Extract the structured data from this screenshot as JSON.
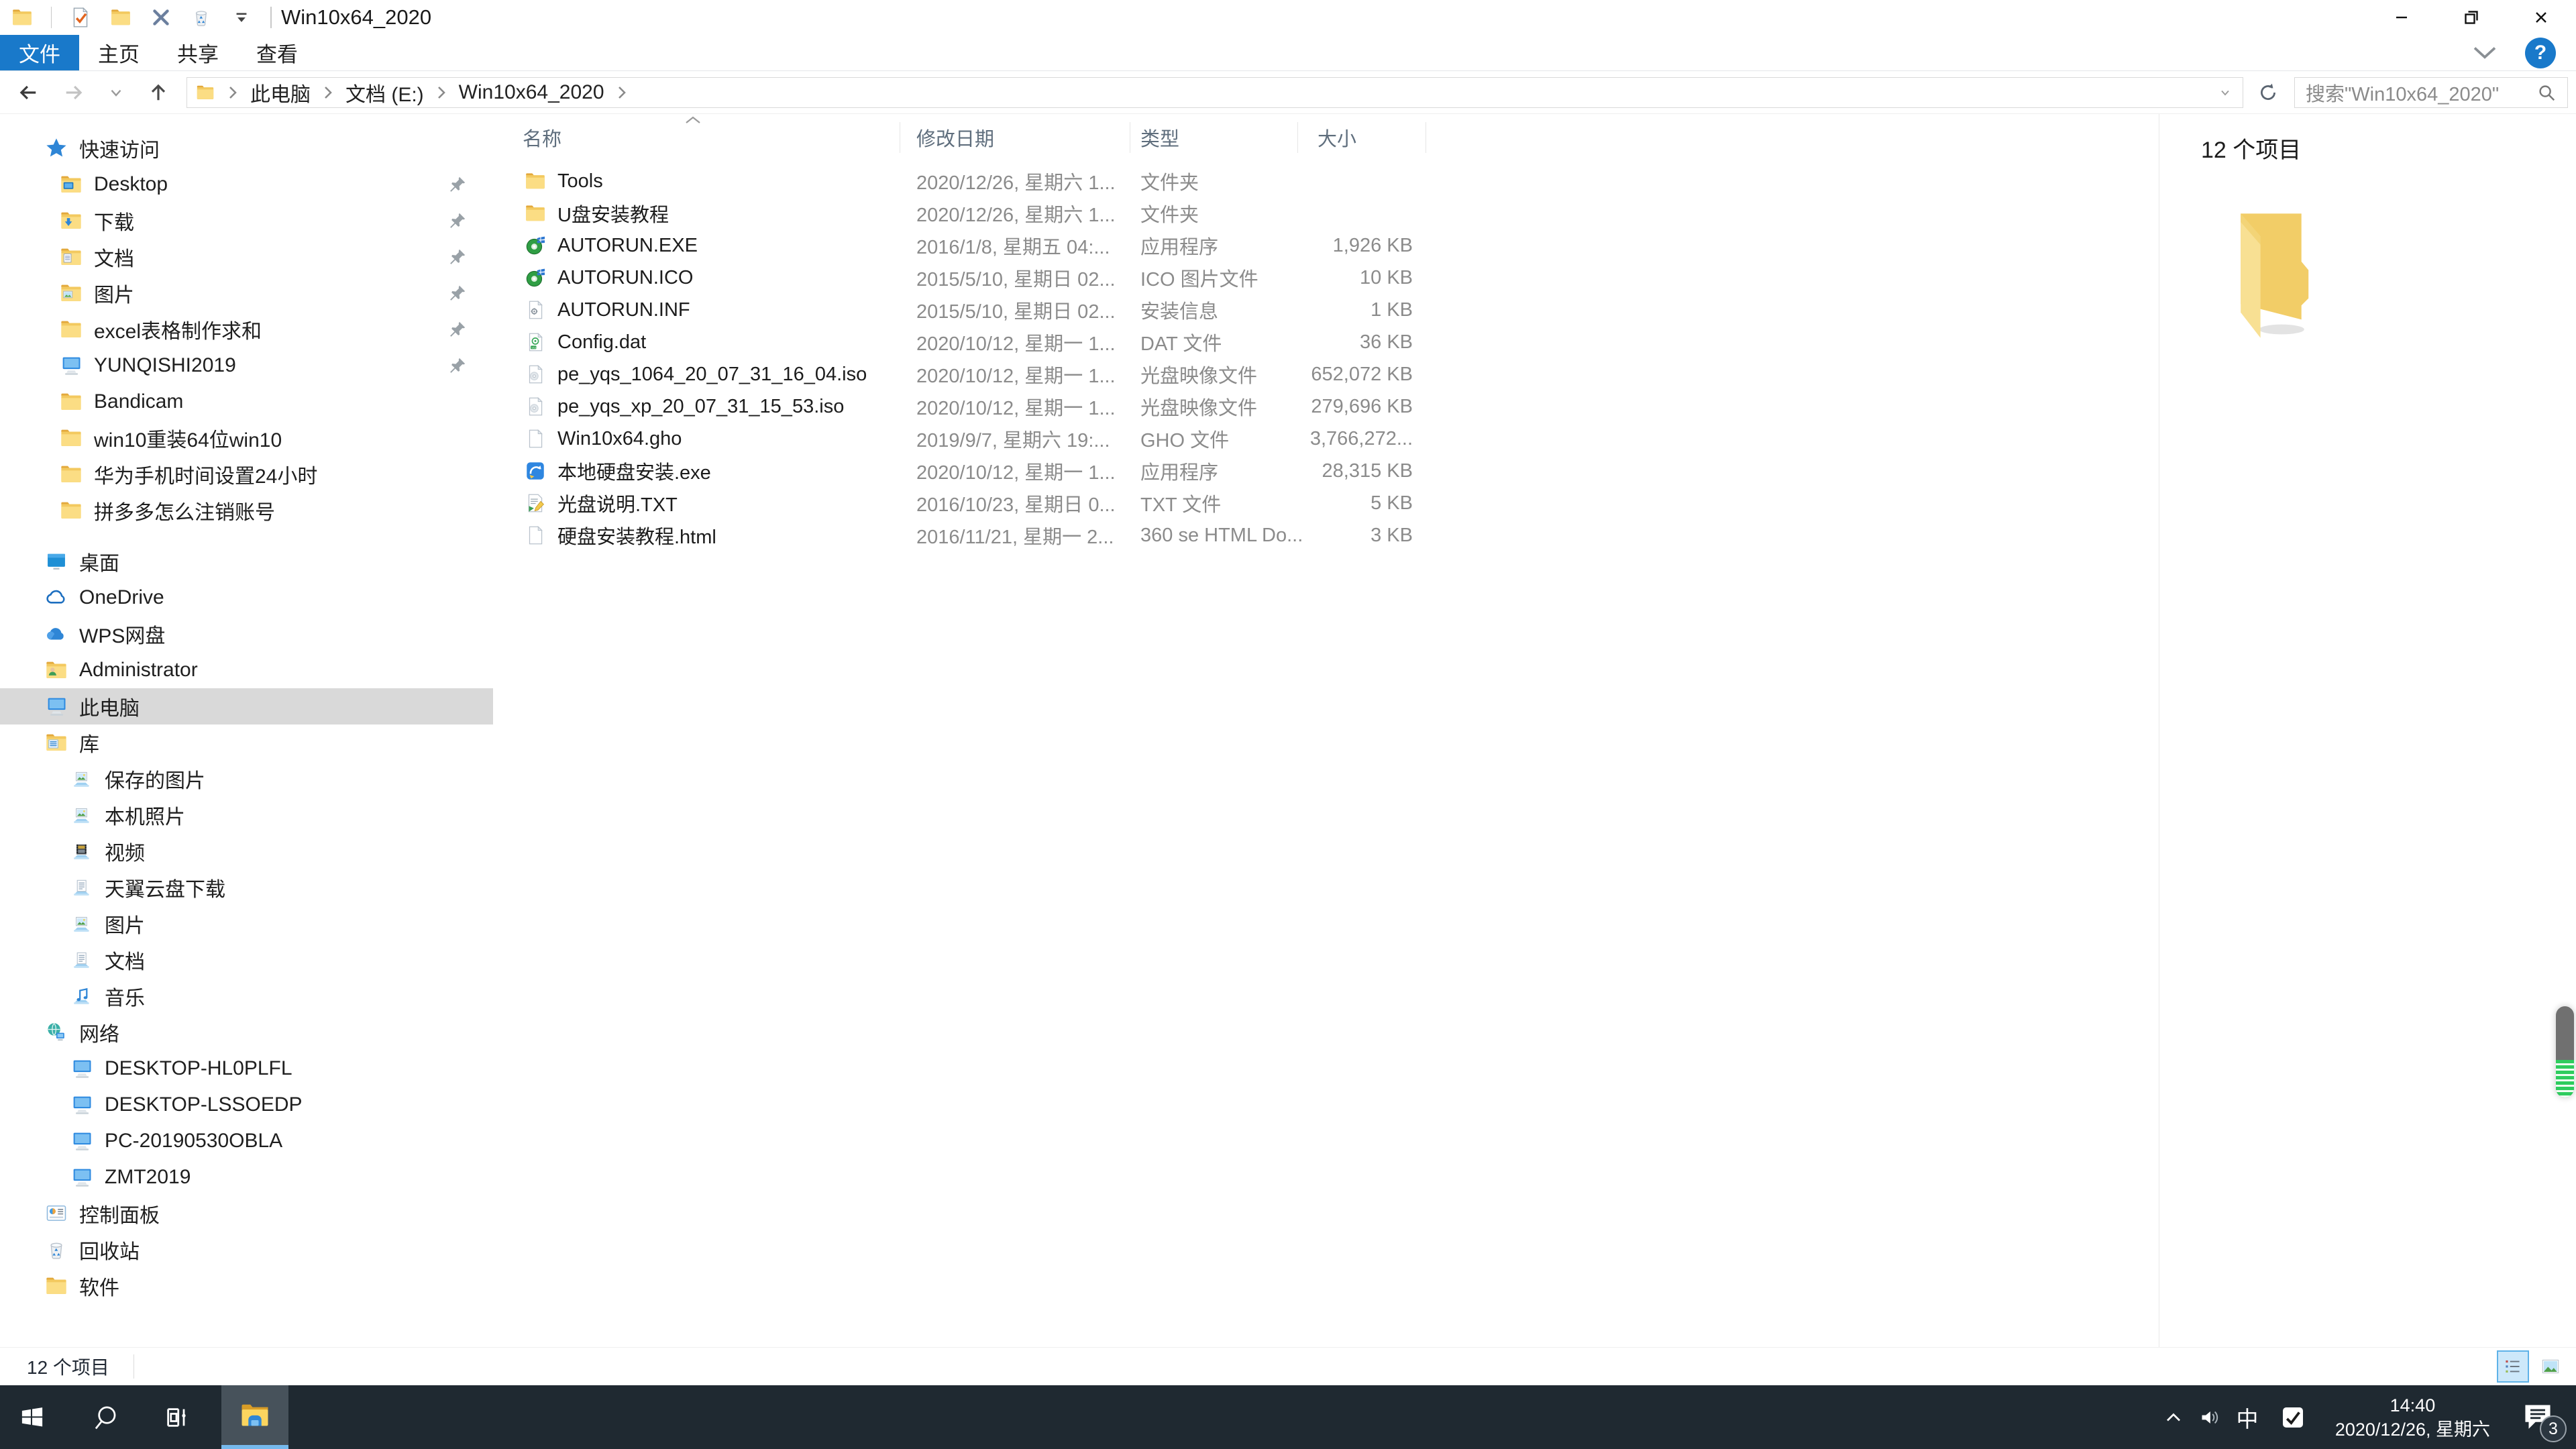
{
  "titlebar": {
    "title": "Win10x64_2020",
    "quick_access": [
      "folder-icon",
      "separator",
      "checked-doc-icon",
      "folder-icon",
      "delete-x-icon",
      "recycle-bin-icon",
      "dropdown-arrow-icon",
      "separator"
    ]
  },
  "ribbon": {
    "tabs": [
      {
        "label": "文件",
        "active": true
      },
      {
        "label": "主页",
        "active": false
      },
      {
        "label": "共享",
        "active": false
      },
      {
        "label": "查看",
        "active": false
      }
    ],
    "help_label": "?"
  },
  "address_bar": {
    "breadcrumbs": [
      "此电脑",
      "文档 (E:)",
      "Win10x64_2020"
    ],
    "search_placeholder": "搜索\"Win10x64_2020\""
  },
  "sidebar": {
    "items": [
      {
        "label": "快速访问",
        "icon": "quick-access-star-icon",
        "level": 0
      },
      {
        "label": "Desktop",
        "icon": "folder-desktop-icon",
        "level": 1,
        "pinned": true
      },
      {
        "label": "下载",
        "icon": "folder-download-icon",
        "level": 1,
        "pinned": true
      },
      {
        "label": "文档",
        "icon": "folder-documents-icon",
        "level": 1,
        "pinned": true
      },
      {
        "label": "图片",
        "icon": "folder-pictures-icon",
        "level": 1,
        "pinned": true
      },
      {
        "label": "excel表格制作求和",
        "icon": "folder-icon",
        "level": 1,
        "pinned": true
      },
      {
        "label": "YUNQISHI2019",
        "icon": "computer-icon",
        "level": 1,
        "pinned": true
      },
      {
        "label": "Bandicam",
        "icon": "folder-icon",
        "level": 1
      },
      {
        "label": "win10重装64位win10",
        "icon": "folder-icon",
        "level": 1
      },
      {
        "label": "华为手机时间设置24小时",
        "icon": "folder-icon",
        "level": 1
      },
      {
        "label": "拼多多怎么注销账号",
        "icon": "folder-icon",
        "level": 1
      },
      {
        "label": "桌面",
        "icon": "desktop-icon",
        "level": 0,
        "spacer_before": true
      },
      {
        "label": "OneDrive",
        "icon": "onedrive-icon",
        "level": 0
      },
      {
        "label": "WPS网盘",
        "icon": "wps-cloud-icon",
        "level": 0
      },
      {
        "label": "Administrator",
        "icon": "folder-user-icon",
        "level": 0
      },
      {
        "label": "此电脑",
        "icon": "computer-icon",
        "level": 0,
        "selected": true
      },
      {
        "label": "库",
        "icon": "library-icon",
        "level": 0
      },
      {
        "label": "保存的图片",
        "icon": "lib-pictures-icon",
        "level": 2
      },
      {
        "label": "本机照片",
        "icon": "lib-pictures-icon",
        "level": 2
      },
      {
        "label": "视频",
        "icon": "lib-videos-icon",
        "level": 2
      },
      {
        "label": "天翼云盘下载",
        "icon": "lib-documents-icon",
        "level": 2
      },
      {
        "label": "图片",
        "icon": "lib-pictures-icon",
        "level": 2
      },
      {
        "label": "文档",
        "icon": "lib-documents-icon",
        "level": 2
      },
      {
        "label": "音乐",
        "icon": "lib-music-icon",
        "level": 2
      },
      {
        "label": "网络",
        "icon": "network-icon",
        "level": 0
      },
      {
        "label": "DESKTOP-HL0PLFL",
        "icon": "computer-icon",
        "level": 2
      },
      {
        "label": "DESKTOP-LSSOEDP",
        "icon": "computer-icon",
        "level": 2
      },
      {
        "label": "PC-20190530OBLA",
        "icon": "computer-icon",
        "level": 2
      },
      {
        "label": "ZMT2019",
        "icon": "computer-icon",
        "level": 2
      },
      {
        "label": "控制面板",
        "icon": "control-panel-icon",
        "level": 0
      },
      {
        "label": "回收站",
        "icon": "recycle-bin-icon",
        "level": 0
      },
      {
        "label": "软件",
        "icon": "folder-icon",
        "level": 0
      }
    ]
  },
  "file_list": {
    "columns": [
      {
        "label": "名称",
        "sorted": true
      },
      {
        "label": "修改日期",
        "sorted": false
      },
      {
        "label": "类型",
        "sorted": false
      },
      {
        "label": "大小",
        "sorted": false
      }
    ],
    "rows": [
      {
        "icon": "folder-icon",
        "name": "Tools",
        "date": "2020/12/26, 星期六 1...",
        "type": "文件夹",
        "size": ""
      },
      {
        "icon": "folder-icon",
        "name": "U盘安装教程",
        "date": "2020/12/26, 星期六 1...",
        "type": "文件夹",
        "size": ""
      },
      {
        "icon": "autorun-icon",
        "name": "AUTORUN.EXE",
        "date": "2016/1/8, 星期五 04:...",
        "type": "应用程序",
        "size": "1,926 KB"
      },
      {
        "icon": "autorun-icon",
        "name": "AUTORUN.ICO",
        "date": "2015/5/10, 星期日 02...",
        "type": "ICO 图片文件",
        "size": "10 KB"
      },
      {
        "icon": "inf-file-icon",
        "name": "AUTORUN.INF",
        "date": "2015/5/10, 星期日 02...",
        "type": "安装信息",
        "size": "1 KB"
      },
      {
        "icon": "dat-file-icon",
        "name": "Config.dat",
        "date": "2020/10/12, 星期一 1...",
        "type": "DAT 文件",
        "size": "36 KB"
      },
      {
        "icon": "iso-file-icon",
        "name": "pe_yqs_1064_20_07_31_16_04.iso",
        "date": "2020/10/12, 星期一 1...",
        "type": "光盘映像文件",
        "size": "652,072 KB"
      },
      {
        "icon": "iso-file-icon",
        "name": "pe_yqs_xp_20_07_31_15_53.iso",
        "date": "2020/10/12, 星期一 1...",
        "type": "光盘映像文件",
        "size": "279,696 KB"
      },
      {
        "icon": "plain-file-icon",
        "name": "Win10x64.gho",
        "date": "2019/9/7, 星期六 19:...",
        "type": "GHO 文件",
        "size": "3,766,272..."
      },
      {
        "icon": "app-blue-icon",
        "name": "本地硬盘安装.exe",
        "date": "2020/10/12, 星期一 1...",
        "type": "应用程序",
        "size": "28,315 KB"
      },
      {
        "icon": "txt-file-icon",
        "name": "光盘说明.TXT",
        "date": "2016/10/23, 星期日 0...",
        "type": "TXT 文件",
        "size": "5 KB"
      },
      {
        "icon": "plain-file-icon",
        "name": "硬盘安装教程.html",
        "date": "2016/11/21, 星期一 2...",
        "type": "360 se HTML Do...",
        "size": "3 KB"
      }
    ]
  },
  "preview_pane": {
    "header": "12 个项目"
  },
  "status_bar": {
    "items_count": "12 个项目",
    "view_buttons": [
      {
        "icon": "details-view-icon",
        "selected": true
      },
      {
        "icon": "thumbnail-view-icon",
        "selected": false
      }
    ]
  },
  "taskbar": {
    "ime": "中",
    "time": "14:40",
    "date": "2020/12/26, 星期六",
    "notifications_badge": "3"
  },
  "colors": {
    "accent_blue": "#1979ca",
    "taskbar_bg": "#1f2931",
    "selection_gray": "#d9d9d9",
    "folder_yellow": "#f7d374",
    "scrollbar_green": "#2ecc5e"
  }
}
